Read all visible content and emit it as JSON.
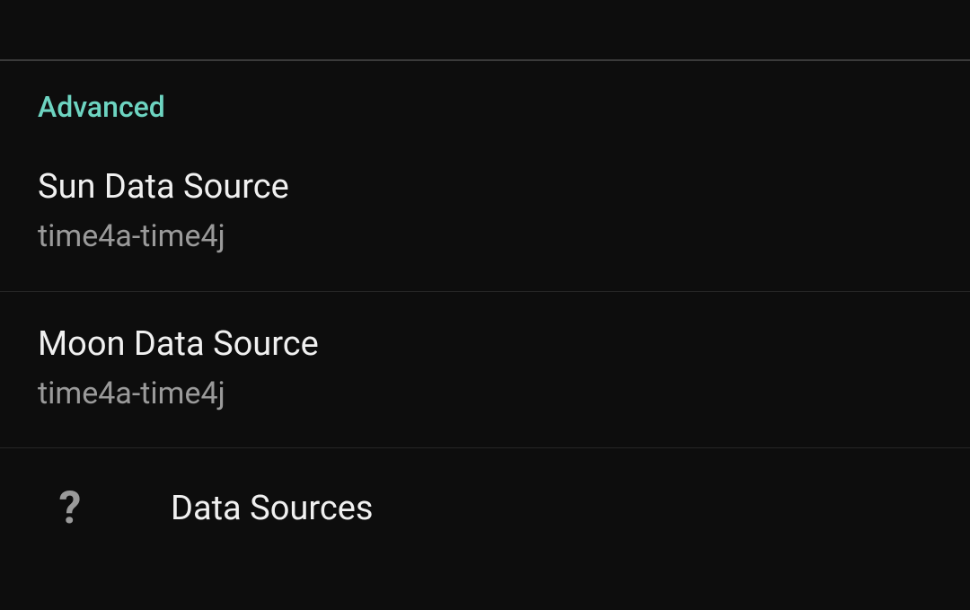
{
  "section": {
    "header": "Advanced"
  },
  "settings": {
    "sun": {
      "title": "Sun Data Source",
      "subtitle": "time4a-time4j"
    },
    "moon": {
      "title": "Moon Data Source",
      "subtitle": "time4a-time4j"
    }
  },
  "info": {
    "dataSources": {
      "title": "Data Sources",
      "icon": "?"
    }
  }
}
